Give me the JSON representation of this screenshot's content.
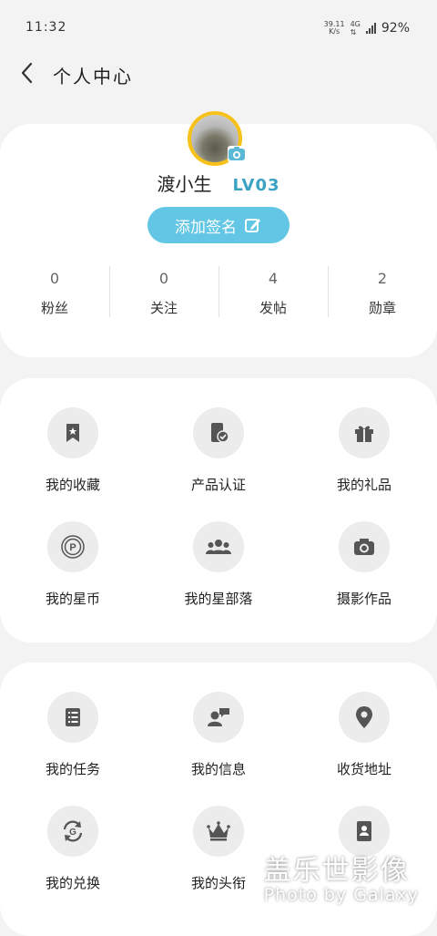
{
  "status_bar": {
    "time": "11:32",
    "net_speed_value": "39.11",
    "net_speed_unit": "K/s",
    "network_type": "4G",
    "battery": "92%"
  },
  "header": {
    "title": "个人中心"
  },
  "profile": {
    "name": "渡小生",
    "level": "LV03",
    "sign_button": "添加签名",
    "stats": [
      {
        "value": "0",
        "label": "粉丝"
      },
      {
        "value": "0",
        "label": "关注"
      },
      {
        "value": "4",
        "label": "发帖"
      },
      {
        "value": "2",
        "label": "勋章"
      }
    ]
  },
  "menu1": [
    {
      "label": "我的收藏",
      "icon": "bookmark-star-icon"
    },
    {
      "label": "产品认证",
      "icon": "device-check-icon"
    },
    {
      "label": "我的礼品",
      "icon": "gift-icon"
    },
    {
      "label": "我的星币",
      "icon": "coin-icon"
    },
    {
      "label": "我的星部落",
      "icon": "group-icon"
    },
    {
      "label": "摄影作品",
      "icon": "camera-icon"
    }
  ],
  "menu2": [
    {
      "label": "我的任务",
      "icon": "task-list-icon"
    },
    {
      "label": "我的信息",
      "icon": "user-message-icon"
    },
    {
      "label": "收货地址",
      "icon": "location-pin-icon"
    },
    {
      "label": "我的兑换",
      "icon": "exchange-icon"
    },
    {
      "label": "我的头衔",
      "icon": "crown-icon"
    },
    {
      "label": "",
      "icon": "badge-card-icon"
    }
  ],
  "watermark": {
    "chinese": "盖乐世影像",
    "english": "Photo by Galaxy"
  }
}
